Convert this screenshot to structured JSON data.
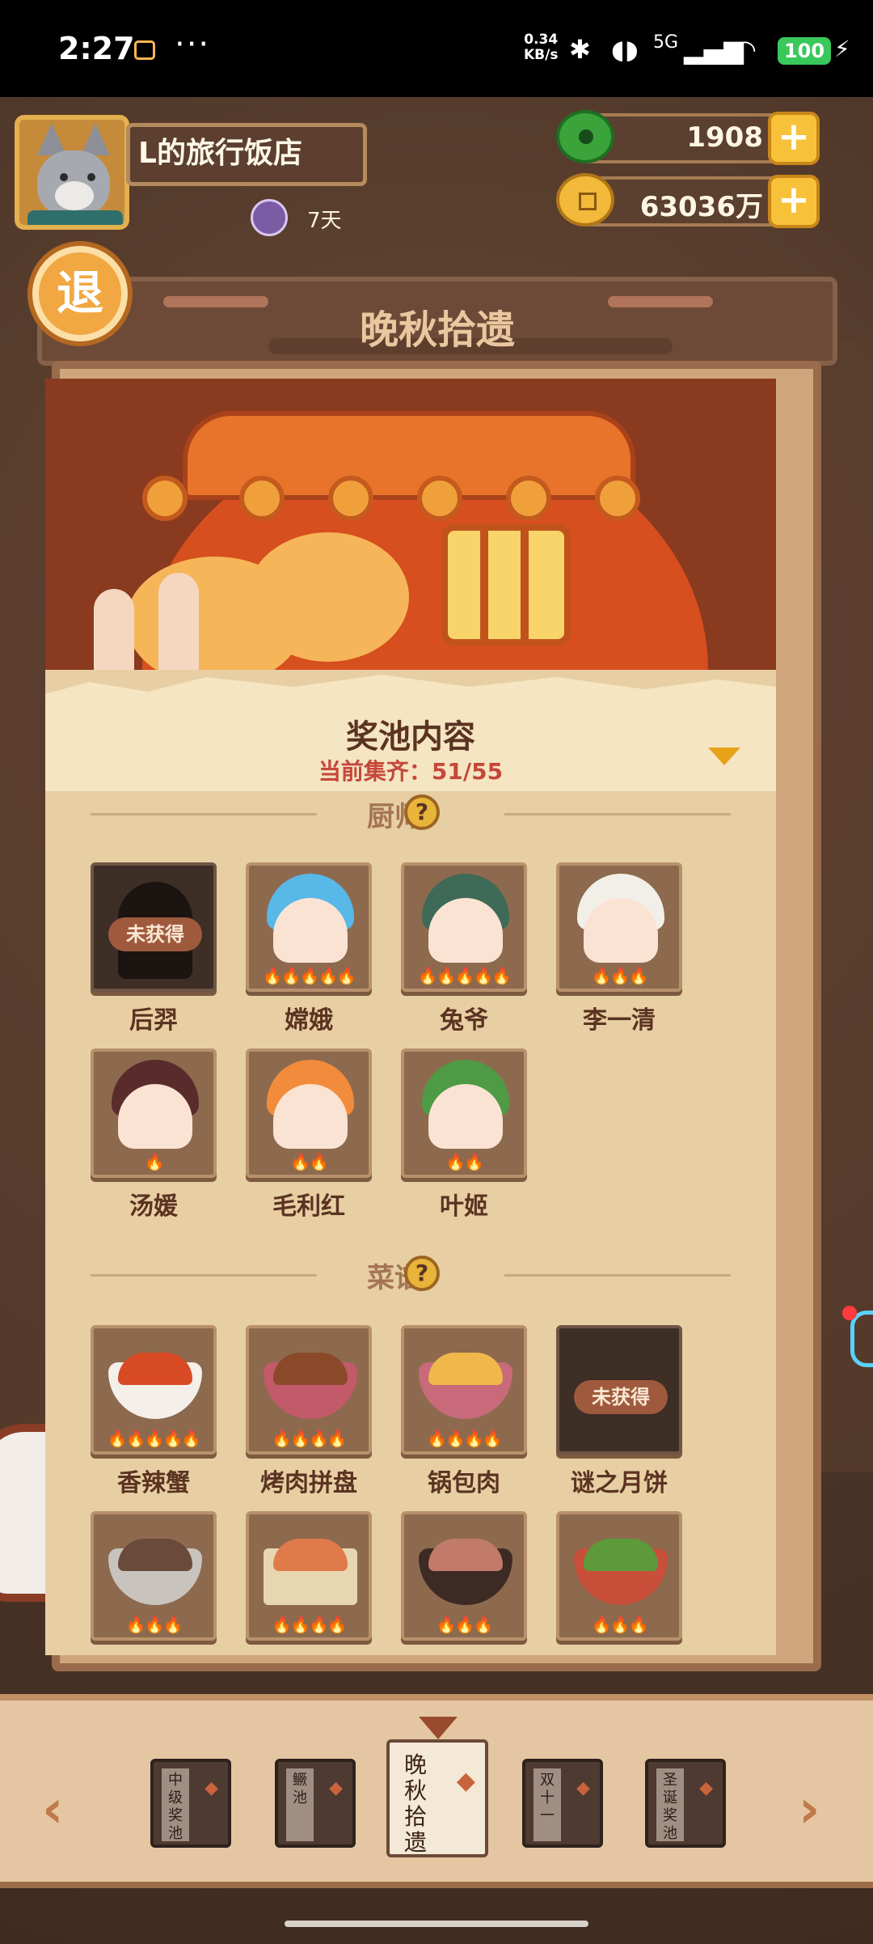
{
  "status_bar": {
    "time": "2:27",
    "dots": "···",
    "speed": "0.34",
    "speed_unit": "KB/s",
    "network": "5G",
    "battery": "100"
  },
  "player": {
    "shop_name": "L的旅行饭店",
    "helper_days": "7天"
  },
  "resources": {
    "jade": "1908",
    "coins": "63036万"
  },
  "exit_label": "退",
  "title": "晚秋拾遗",
  "pool": {
    "heading": "奖池内容",
    "collected": "当前集齐：51/55"
  },
  "chef_section": {
    "label": "厨师",
    "help": "?",
    "items": [
      {
        "name": "后羿",
        "locked": true,
        "lock_text": "未获得"
      },
      {
        "name": "嫦娥",
        "locked": false
      },
      {
        "name": "兔爷",
        "locked": false
      },
      {
        "name": "李一清",
        "locked": false
      },
      {
        "name": "汤媛",
        "locked": false
      },
      {
        "name": "毛利红",
        "locked": false
      },
      {
        "name": "叶姬",
        "locked": false
      }
    ]
  },
  "recipe_section": {
    "label": "菜谱",
    "help": "?",
    "items": [
      {
        "name": "香辣蟹",
        "locked": false
      },
      {
        "name": "烤肉拼盘",
        "locked": false
      },
      {
        "name": "锅包肉",
        "locked": false
      },
      {
        "name": "谜之月饼",
        "locked": true,
        "lock_text": "未获得"
      }
    ]
  },
  "pool_tabs": [
    {
      "label": "中级奖池",
      "active": false
    },
    {
      "label": "鳜池",
      "active": false
    },
    {
      "label": "晚秋拾遗",
      "active": true
    },
    {
      "label": "双十一",
      "active": false
    },
    {
      "label": "圣诞奖池",
      "active": false
    }
  ],
  "nav": {
    "prev": "‹",
    "next": "›"
  },
  "colors": {
    "accent_gold": "#f7c23a",
    "lock_red": "#c4483a",
    "flame": "#f0661c"
  }
}
